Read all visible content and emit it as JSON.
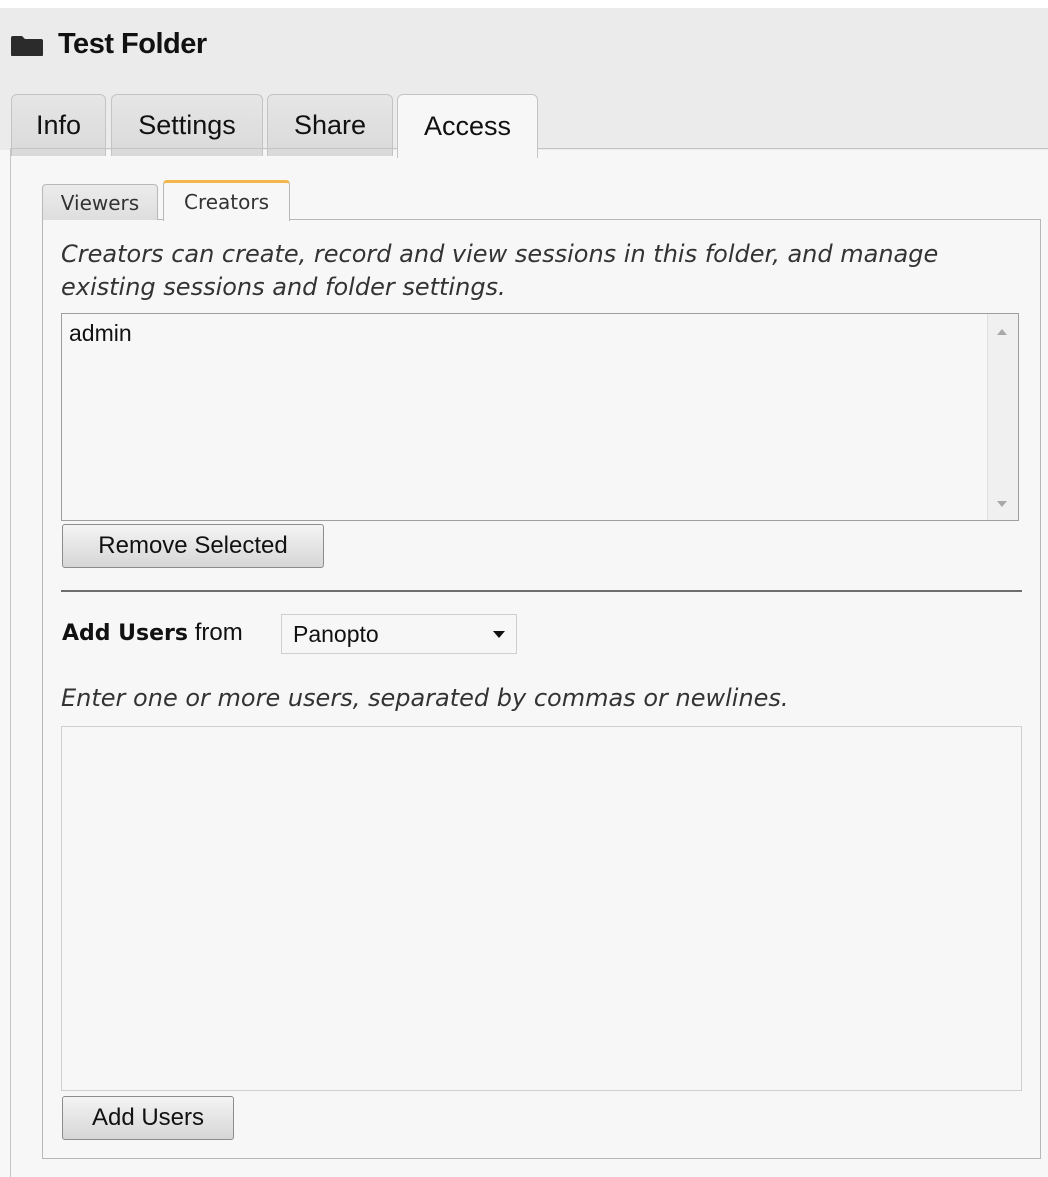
{
  "header": {
    "icon": "folder-icon",
    "title": "Test Folder"
  },
  "tabs": [
    {
      "label": "Info",
      "active": false
    },
    {
      "label": "Settings",
      "active": false
    },
    {
      "label": "Share",
      "active": false
    },
    {
      "label": "Access",
      "active": true
    }
  ],
  "subtabs": [
    {
      "label": "Viewers",
      "active": false
    },
    {
      "label": "Creators",
      "active": true
    }
  ],
  "creators": {
    "description": "Creators can create, record and view sessions in this folder, and manage existing sessions and folder settings.",
    "list_items": [
      "admin"
    ],
    "remove_button": "Remove Selected"
  },
  "add_users": {
    "label_bold": "Add Users",
    "label_from": "from",
    "provider_selected": "Panopto",
    "instructions": "Enter one or more users, separated by commas or newlines.",
    "input_value": "",
    "add_button": "Add Users"
  },
  "colors": {
    "active_subtab_accent": "#f2b64a",
    "panel_background": "#f7f7f7",
    "header_background": "#ebebeb"
  }
}
